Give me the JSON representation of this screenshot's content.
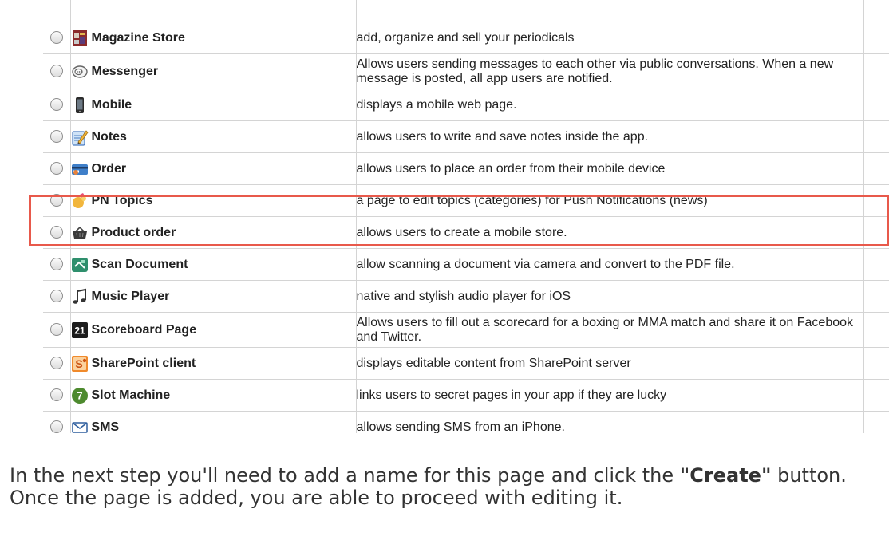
{
  "modules": [
    {
      "name": "Magazine Store",
      "icon": "magazine-icon",
      "description": "add, organize and sell your periodicals",
      "rowHeight": "h40"
    },
    {
      "name": "Messenger",
      "icon": "chat-bubble-icon",
      "description": "Allows users sending messages to each other via public conversations. When a new message is posted, all app users are notified.",
      "rowHeight": "h44"
    },
    {
      "name": "Mobile",
      "icon": "mobile-phone-icon",
      "description": "displays a mobile web page.",
      "rowHeight": "h40"
    },
    {
      "name": "Notes",
      "icon": "notes-pencil-icon",
      "description": "allows users to write and save notes inside the app.",
      "rowHeight": "h40"
    },
    {
      "name": "Order",
      "icon": "order-card-icon",
      "description": "allows users to place an order from their mobile device",
      "rowHeight": "h40"
    },
    {
      "name": "PN Topics",
      "icon": "pn-topics-icon",
      "description": "a page to edit topics (categories) for Push Notifications (news)",
      "rowHeight": "h40"
    },
    {
      "name": "Product order",
      "icon": "shopping-basket-icon",
      "description": "allows users to create a mobile store.",
      "rowHeight": "h40"
    },
    {
      "name": "Scan Document",
      "icon": "scan-document-icon",
      "description": "allow scanning a document via camera and convert to the PDF file.",
      "rowHeight": "h40"
    },
    {
      "name": "Music Player",
      "icon": "music-note-icon",
      "description": "native and stylish audio player for iOS",
      "rowHeight": "h40"
    },
    {
      "name": "Scoreboard Page",
      "icon": "scoreboard-21-icon",
      "description": "Allows users to fill out a scorecard for a boxing or MMA match and share it on Facebook and Twitter.",
      "rowHeight": "h44"
    },
    {
      "name": "SharePoint client",
      "icon": "sharepoint-icon",
      "description": "displays editable content from SharePoint server",
      "rowHeight": "h40"
    },
    {
      "name": "Slot Machine",
      "icon": "slot-machine-7-icon",
      "description": "links users to secret pages in your app if they are lucky",
      "rowHeight": "h40"
    },
    {
      "name": "SMS",
      "icon": "envelope-icon",
      "description": "allows sending SMS from an iPhone.",
      "rowHeight": "h40"
    }
  ],
  "iconGlyphs": {
    "scoreboard": "21",
    "slotMachine": "7",
    "sharepoint": "S"
  },
  "highlight": {
    "module": "Product order",
    "color": "#e8594b"
  },
  "instructions": {
    "before": "In the next step you'll need to add a name for this page and click the ",
    "button": "\"Create\"",
    "after": " button. Once the page is added, you are able to proceed with editing it."
  }
}
